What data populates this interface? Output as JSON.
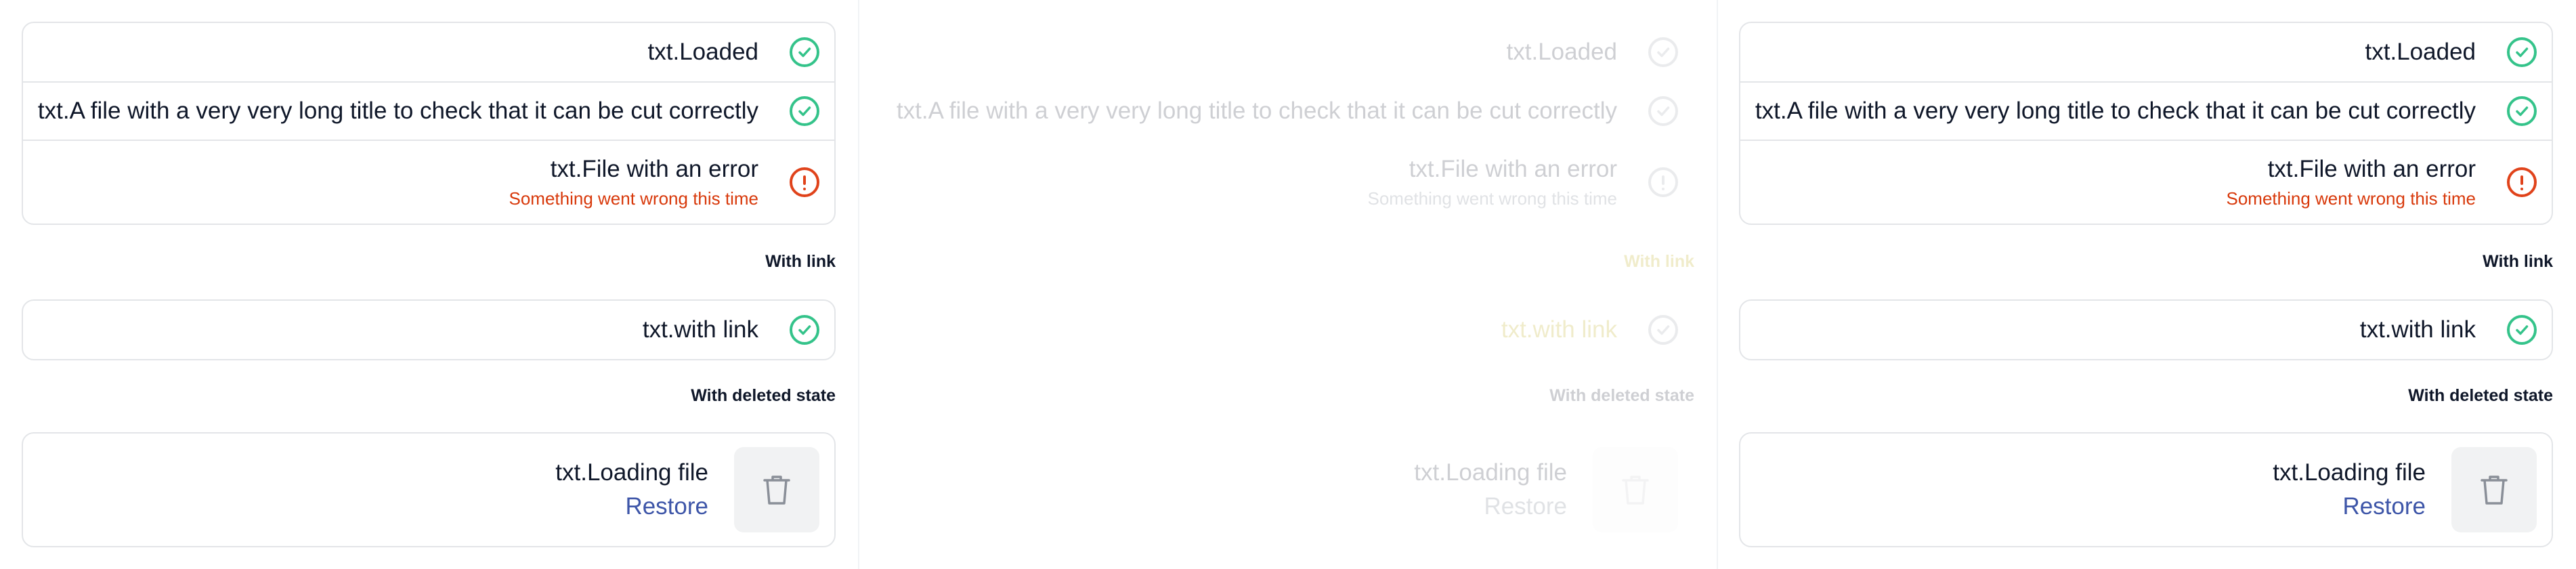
{
  "colors": {
    "success": "#34c38a",
    "error": "#e0421a",
    "error_text": "#d8390b",
    "link": "#3d55a8",
    "border": "#e3e5e8"
  },
  "panels": [
    {
      "state": "normal",
      "files": [
        {
          "name": "txt.Loaded",
          "status": "success",
          "status_icon": "check-circle-icon"
        },
        {
          "name": "txt.A file with a very very long title to check that it can be cut correctly",
          "status": "success",
          "status_icon": "check-circle-icon"
        },
        {
          "name": "txt.File with an error",
          "error": "Something went wrong this time",
          "status": "error",
          "status_icon": "exclamation-circle-icon"
        }
      ],
      "link_section": {
        "label": "With link",
        "file": {
          "name": "txt.with link",
          "status": "success"
        }
      },
      "deleted_section": {
        "label": "With deleted state",
        "file": {
          "name": "txt.Loading file",
          "restore": "Restore",
          "action_icon": "trash-icon"
        }
      }
    },
    {
      "state": "faded",
      "files": [
        {
          "name": "txt.Loaded",
          "status": "success"
        },
        {
          "name": "txt.A file with a very very long title to check that it can be cut correctly",
          "status": "success"
        },
        {
          "name": "txt.File with an error",
          "error": "Something went wrong this time",
          "status": "error"
        }
      ],
      "link_section": {
        "label": "With link",
        "file": {
          "name": "txt.with link",
          "status": "success"
        }
      },
      "deleted_section": {
        "label": "With deleted state",
        "file": {
          "name": "txt.Loading file",
          "restore": "Restore"
        }
      }
    },
    {
      "state": "normal",
      "files": [
        {
          "name": "txt.Loaded",
          "status": "success"
        },
        {
          "name": "txt.A file with a very very long title to check that it can be cut correctly",
          "status": "success"
        },
        {
          "name": "txt.File with an error",
          "error": "Something went wrong this time",
          "status": "error"
        }
      ],
      "link_section": {
        "label": "With link",
        "file": {
          "name": "txt.with link",
          "status": "success"
        }
      },
      "deleted_section": {
        "label": "With deleted state",
        "file": {
          "name": "txt.Loading file",
          "restore": "Restore"
        }
      }
    }
  ]
}
